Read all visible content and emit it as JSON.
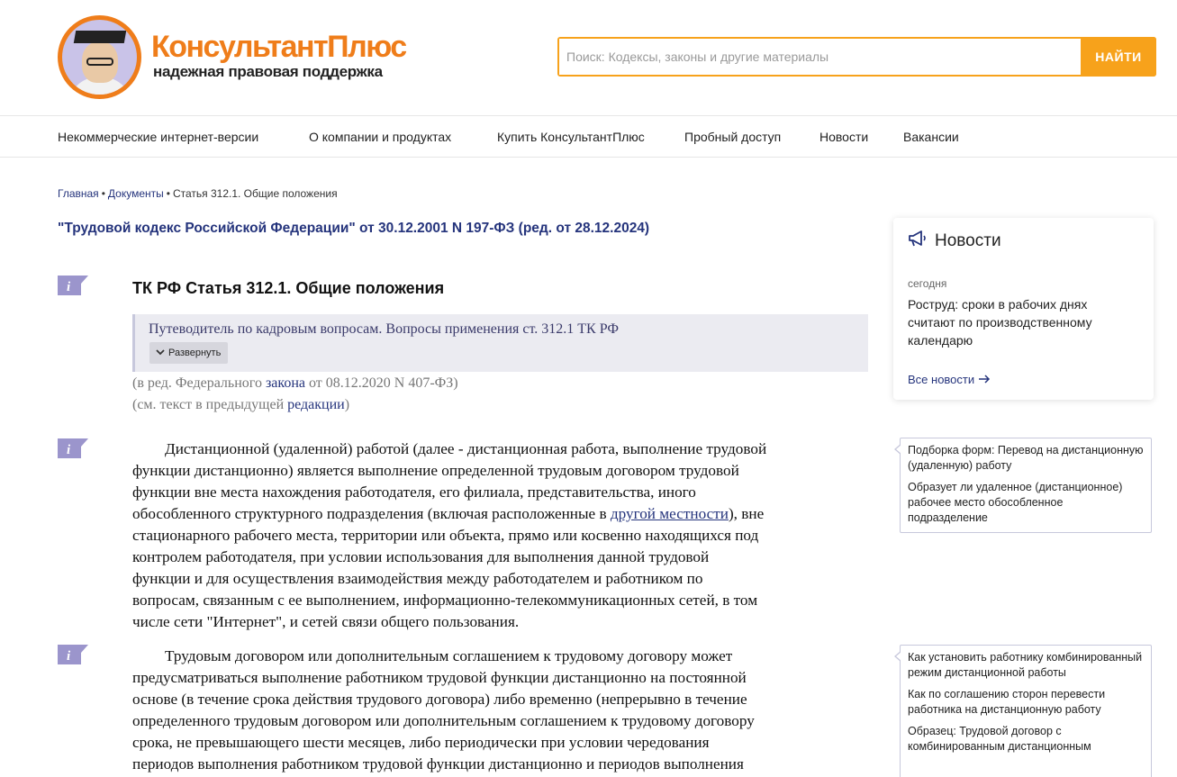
{
  "brand": {
    "name": "КонсультантПлюс",
    "tagline": "надежная правовая поддержка"
  },
  "search": {
    "placeholder": "Поиск: Кодексы, законы и другие материалы",
    "button_label": "НАЙТИ"
  },
  "nav": {
    "items": [
      "Некоммерческие интернет-версии",
      "О компании и продуктах",
      "Купить КонсультантПлюс",
      "Пробный доступ",
      "Новости",
      "Вакансии"
    ]
  },
  "breadcrumb": {
    "home": "Главная",
    "docs": "Документы",
    "current": "Статья 312.1. Общие положения",
    "separator": "•"
  },
  "document": {
    "title": "\"Трудовой кодекс Российской Федерации\" от 30.12.2001 N 197-ФЗ (ред. от 28.12.2024)",
    "article_title": "ТК РФ Статья 312.1. Общие положения",
    "guide_text": "Путеводитель по кадровым вопросам. Вопросы применения ст. 312.1 ТК РФ",
    "expand_label": "Развернуть",
    "edition_1_pre": "(в ред. Федерального ",
    "edition_1_link": "закона",
    "edition_1_post": " от 08.12.2020 N 407-ФЗ)",
    "edition_2_pre": "(см. текст в предыдущей ",
    "edition_2_link": "редакции",
    "edition_2_post": ")",
    "para1": {
      "line1": "Дистанционной (удаленной) работой (далее - дистанционная работа, выполнение трудовой",
      "line2": "функции дистанционно) является выполнение определенной трудовым договором трудовой",
      "line3": "функции вне места нахождения работодателя, его филиала, представительства, иного",
      "line4_pre": "обособленного структурного подразделения (включая расположенные в ",
      "line4_link": "другой местности",
      "line4_post": "), вне",
      "line5": "стационарного рабочего места, территории или объекта, прямо или косвенно находящихся под",
      "line6": "контролем работодателя, при условии использования для выполнения данной трудовой",
      "line7": "функции и для осуществления взаимодействия между работодателем и работником по",
      "line8": "вопросам, связанным с ее выполнением, информационно-телекоммуникационных сетей, в том",
      "line9": "числе сети \"Интернет\", и сетей связи общего пользования."
    },
    "para2": {
      "line1": "Трудовым договором или дополнительным соглашением к трудовому договору может",
      "line2": "предусматриваться выполнение работником трудовой функции дистанционно на постоянной",
      "line3": "основе (в течение срока действия трудового договора) либо временно (непрерывно в течение",
      "line4": "определенного трудовым договором или дополнительным соглашением к трудовому договору",
      "line5": "срока, не превышающего шести месяцев, либо периодически при условии чередования",
      "line6": "периодов выполнения работником трудовой функции дистанционно и периодов выполнения"
    }
  },
  "news": {
    "title": "Новости",
    "date": "сегодня",
    "item": "Роструд: сроки в рабочих днях считают по производственному календарю",
    "all_link": "Все новости"
  },
  "sidebox1": {
    "items": [
      "Подборка форм: Перевод на дистанционную (удаленную) работу",
      "Образует ли удаленное (дистанционное) рабочее место обособленное подразделение"
    ]
  },
  "sidebox2": {
    "items": [
      "Как установить работнику комбинированный режим дистанционной работы",
      "Как по соглашению сторон перевести работника на дистанционную работу",
      "Образец: Трудовой договор с комбинированным дистанционным"
    ]
  },
  "colors": {
    "brand_orange": "#ef7d1a",
    "search_accent": "#f7a21b",
    "link_blue": "#25347c",
    "info_marker": "#9b95cc"
  }
}
